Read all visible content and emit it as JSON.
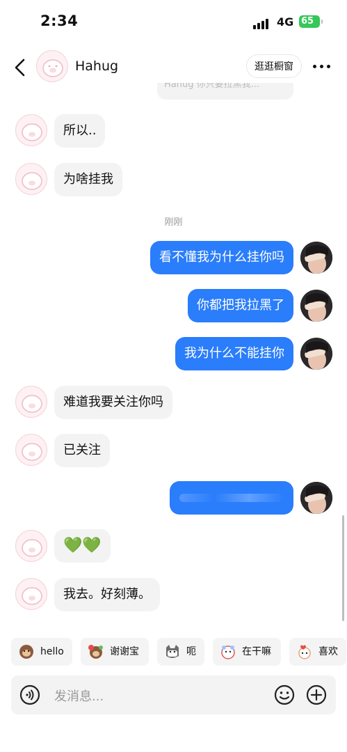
{
  "status_bar": {
    "time": "2:34",
    "network": "4G",
    "battery": "65"
  },
  "header": {
    "title": "Hahug",
    "shop_button": "逛逛橱窗"
  },
  "previous_message_fragment": "Hahug 你只要拉黑我...",
  "messages": [
    {
      "side": "in",
      "text": "所以.."
    },
    {
      "side": "in",
      "text": "为啥挂我"
    },
    {
      "side": "out",
      "text": "看不懂我为什么挂你吗"
    },
    {
      "side": "out",
      "text": "你都把我拉黑了"
    },
    {
      "side": "out",
      "text": "我为什么不能挂你"
    },
    {
      "side": "in",
      "text": "难道我要关注你吗"
    },
    {
      "side": "in",
      "text": "已关注"
    },
    {
      "side": "out",
      "text": ""
    },
    {
      "side": "in",
      "text": "💚💚"
    },
    {
      "side": "in",
      "text": "我去。好刻薄。"
    }
  ],
  "timestamp": "刚刚",
  "quick_replies": [
    {
      "label": "hello",
      "icon": "monkey-sticker-icon"
    },
    {
      "label": "谢谢宝",
      "icon": "monkey-flower-sticker-icon"
    },
    {
      "label": "呃",
      "icon": "cat-sticker-icon"
    },
    {
      "label": "在干嘛",
      "icon": "bear-sticker-icon"
    },
    {
      "label": "喜欢",
      "icon": "heart-bear-sticker-icon"
    }
  ],
  "input": {
    "placeholder": "发消息..."
  },
  "colors": {
    "outgoing": "#2a7dfb",
    "incoming": "#f3f3f3",
    "battery": "#35c759"
  }
}
